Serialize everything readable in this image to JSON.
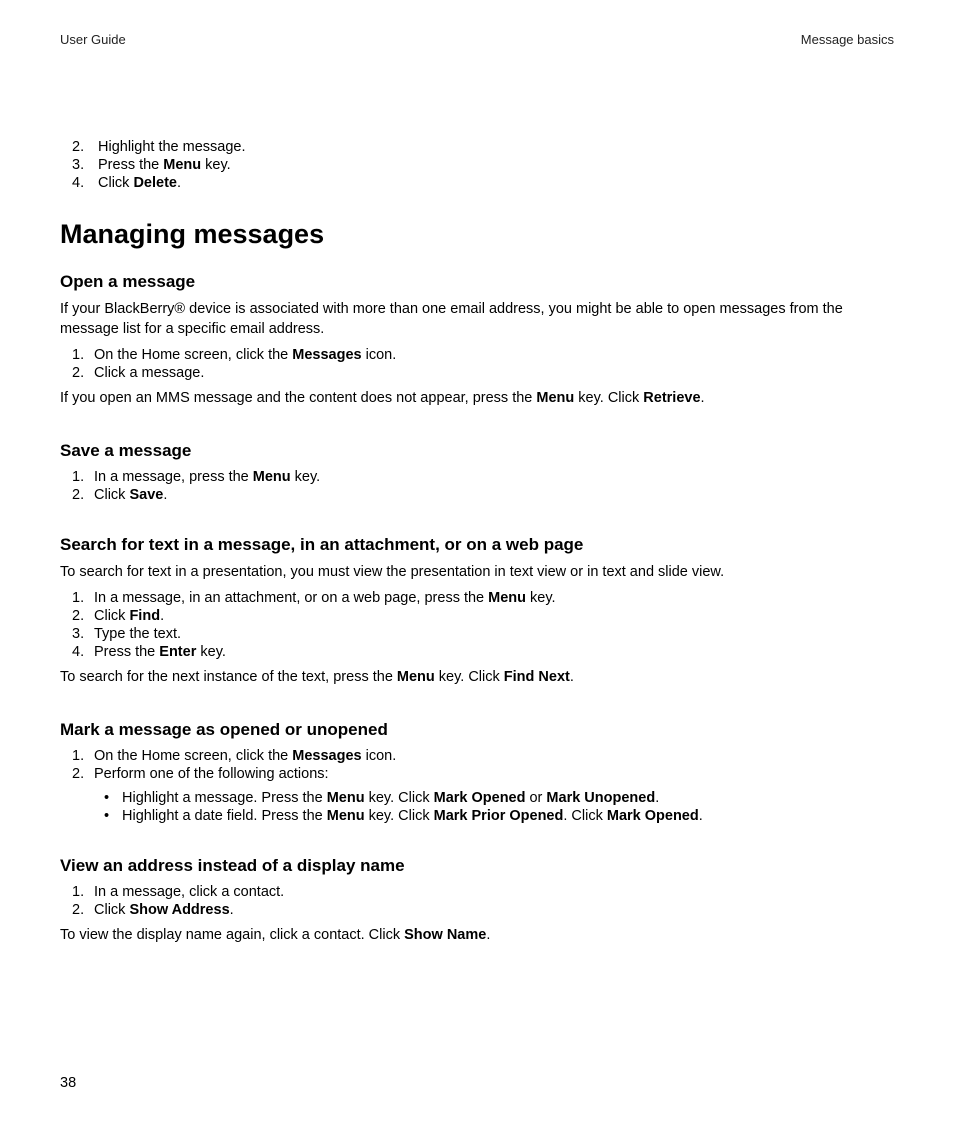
{
  "header": {
    "left": "User Guide",
    "right": "Message basics"
  },
  "page_number": "38",
  "initial_steps": [
    {
      "num": "2.",
      "parts": [
        "Highlight the message."
      ]
    },
    {
      "num": "3.",
      "parts": [
        "Press the ",
        "Menu",
        " key."
      ]
    },
    {
      "num": "4.",
      "parts": [
        "Click ",
        "Delete",
        "."
      ]
    }
  ],
  "h1": "Managing messages",
  "sections": {
    "open": {
      "title": "Open a message",
      "intro_parts": [
        "If your BlackBerry® device is associated with more than one email address, you might be able to open messages from the message list for a specific email address."
      ],
      "steps": [
        {
          "num": "1.",
          "parts": [
            "On the Home screen, click the ",
            "Messages",
            " icon."
          ]
        },
        {
          "num": "2.",
          "parts": [
            "Click a message."
          ]
        }
      ],
      "after_parts": [
        "If you open an MMS message and the content does not appear, press the ",
        "Menu",
        " key. Click ",
        "Retrieve",
        "."
      ]
    },
    "save": {
      "title": "Save a message",
      "steps": [
        {
          "num": "1.",
          "parts": [
            "In a message, press the ",
            "Menu",
            " key."
          ]
        },
        {
          "num": "2.",
          "parts": [
            "Click ",
            "Save",
            "."
          ]
        }
      ]
    },
    "search": {
      "title": "Search for text in a message, in an attachment, or on a web page",
      "intro_parts": [
        "To search for text in a presentation, you must view the presentation in text view or in text and slide view."
      ],
      "steps": [
        {
          "num": "1.",
          "parts": [
            "In a message, in an attachment, or on a web page, press the ",
            "Menu",
            " key."
          ]
        },
        {
          "num": "2.",
          "parts": [
            "Click ",
            "Find",
            "."
          ]
        },
        {
          "num": "3.",
          "parts": [
            "Type the text."
          ]
        },
        {
          "num": "4.",
          "parts": [
            "Press the ",
            "Enter",
            " key."
          ]
        }
      ],
      "after_parts": [
        "To search for the next instance of the text, press the ",
        "Menu",
        " key. Click ",
        "Find Next",
        "."
      ]
    },
    "mark": {
      "title": "Mark a message as opened or unopened",
      "steps": [
        {
          "num": "1.",
          "parts": [
            "On the Home screen, click the ",
            "Messages",
            " icon."
          ]
        },
        {
          "num": "2.",
          "parts": [
            "Perform one of the following actions:"
          ]
        }
      ],
      "sub": [
        [
          "Highlight a message. Press the ",
          "Menu",
          " key. Click ",
          "Mark Opened",
          " or ",
          "Mark Unopened",
          "."
        ],
        [
          "Highlight a date field. Press the ",
          "Menu",
          " key. Click ",
          "Mark Prior Opened",
          ". Click ",
          "Mark Opened",
          "."
        ]
      ]
    },
    "view": {
      "title": "View an address instead of a display name",
      "steps": [
        {
          "num": "1.",
          "parts": [
            "In a message, click a contact."
          ]
        },
        {
          "num": "2.",
          "parts": [
            "Click ",
            "Show Address",
            "."
          ]
        }
      ],
      "after_parts": [
        "To view the display name again, click a contact. Click ",
        "Show Name",
        "."
      ]
    }
  }
}
